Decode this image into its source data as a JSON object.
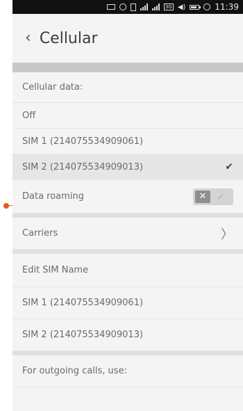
{
  "statusbar": {
    "time": "11:39",
    "icons": [
      "envelope-icon",
      "gps-icon",
      "sim-icon",
      "signal-icon",
      "signal-icon",
      "3g-icon",
      "volume-icon",
      "battery-icon",
      "clock-icon"
    ],
    "network_label": "3G"
  },
  "header": {
    "back_glyph": "‹",
    "title": "Cellular"
  },
  "rows": {
    "cellular_data": "Cellular data:",
    "off": "Off",
    "sim1": "SIM 1 (214075534909061)",
    "sim2": "SIM 2 (214075534909013)",
    "data_roaming": "Data roaming",
    "carriers": "Carriers",
    "edit_sim_name": "Edit SIM Name",
    "sim1_name": "SIM 1 (214075534909061)",
    "sim2_name": "SIM 2 (214075534909013)",
    "outgoing_calls": "For outgoing calls, use:"
  },
  "toggle": {
    "off_glyph": "✕",
    "on_glyph": "✓",
    "state": "off"
  },
  "selected_sim": "SIM 2",
  "colors": {
    "accent_pointer": "#e05a1e",
    "selected_row": "#e6e6e6",
    "statusbar": "#111111"
  }
}
